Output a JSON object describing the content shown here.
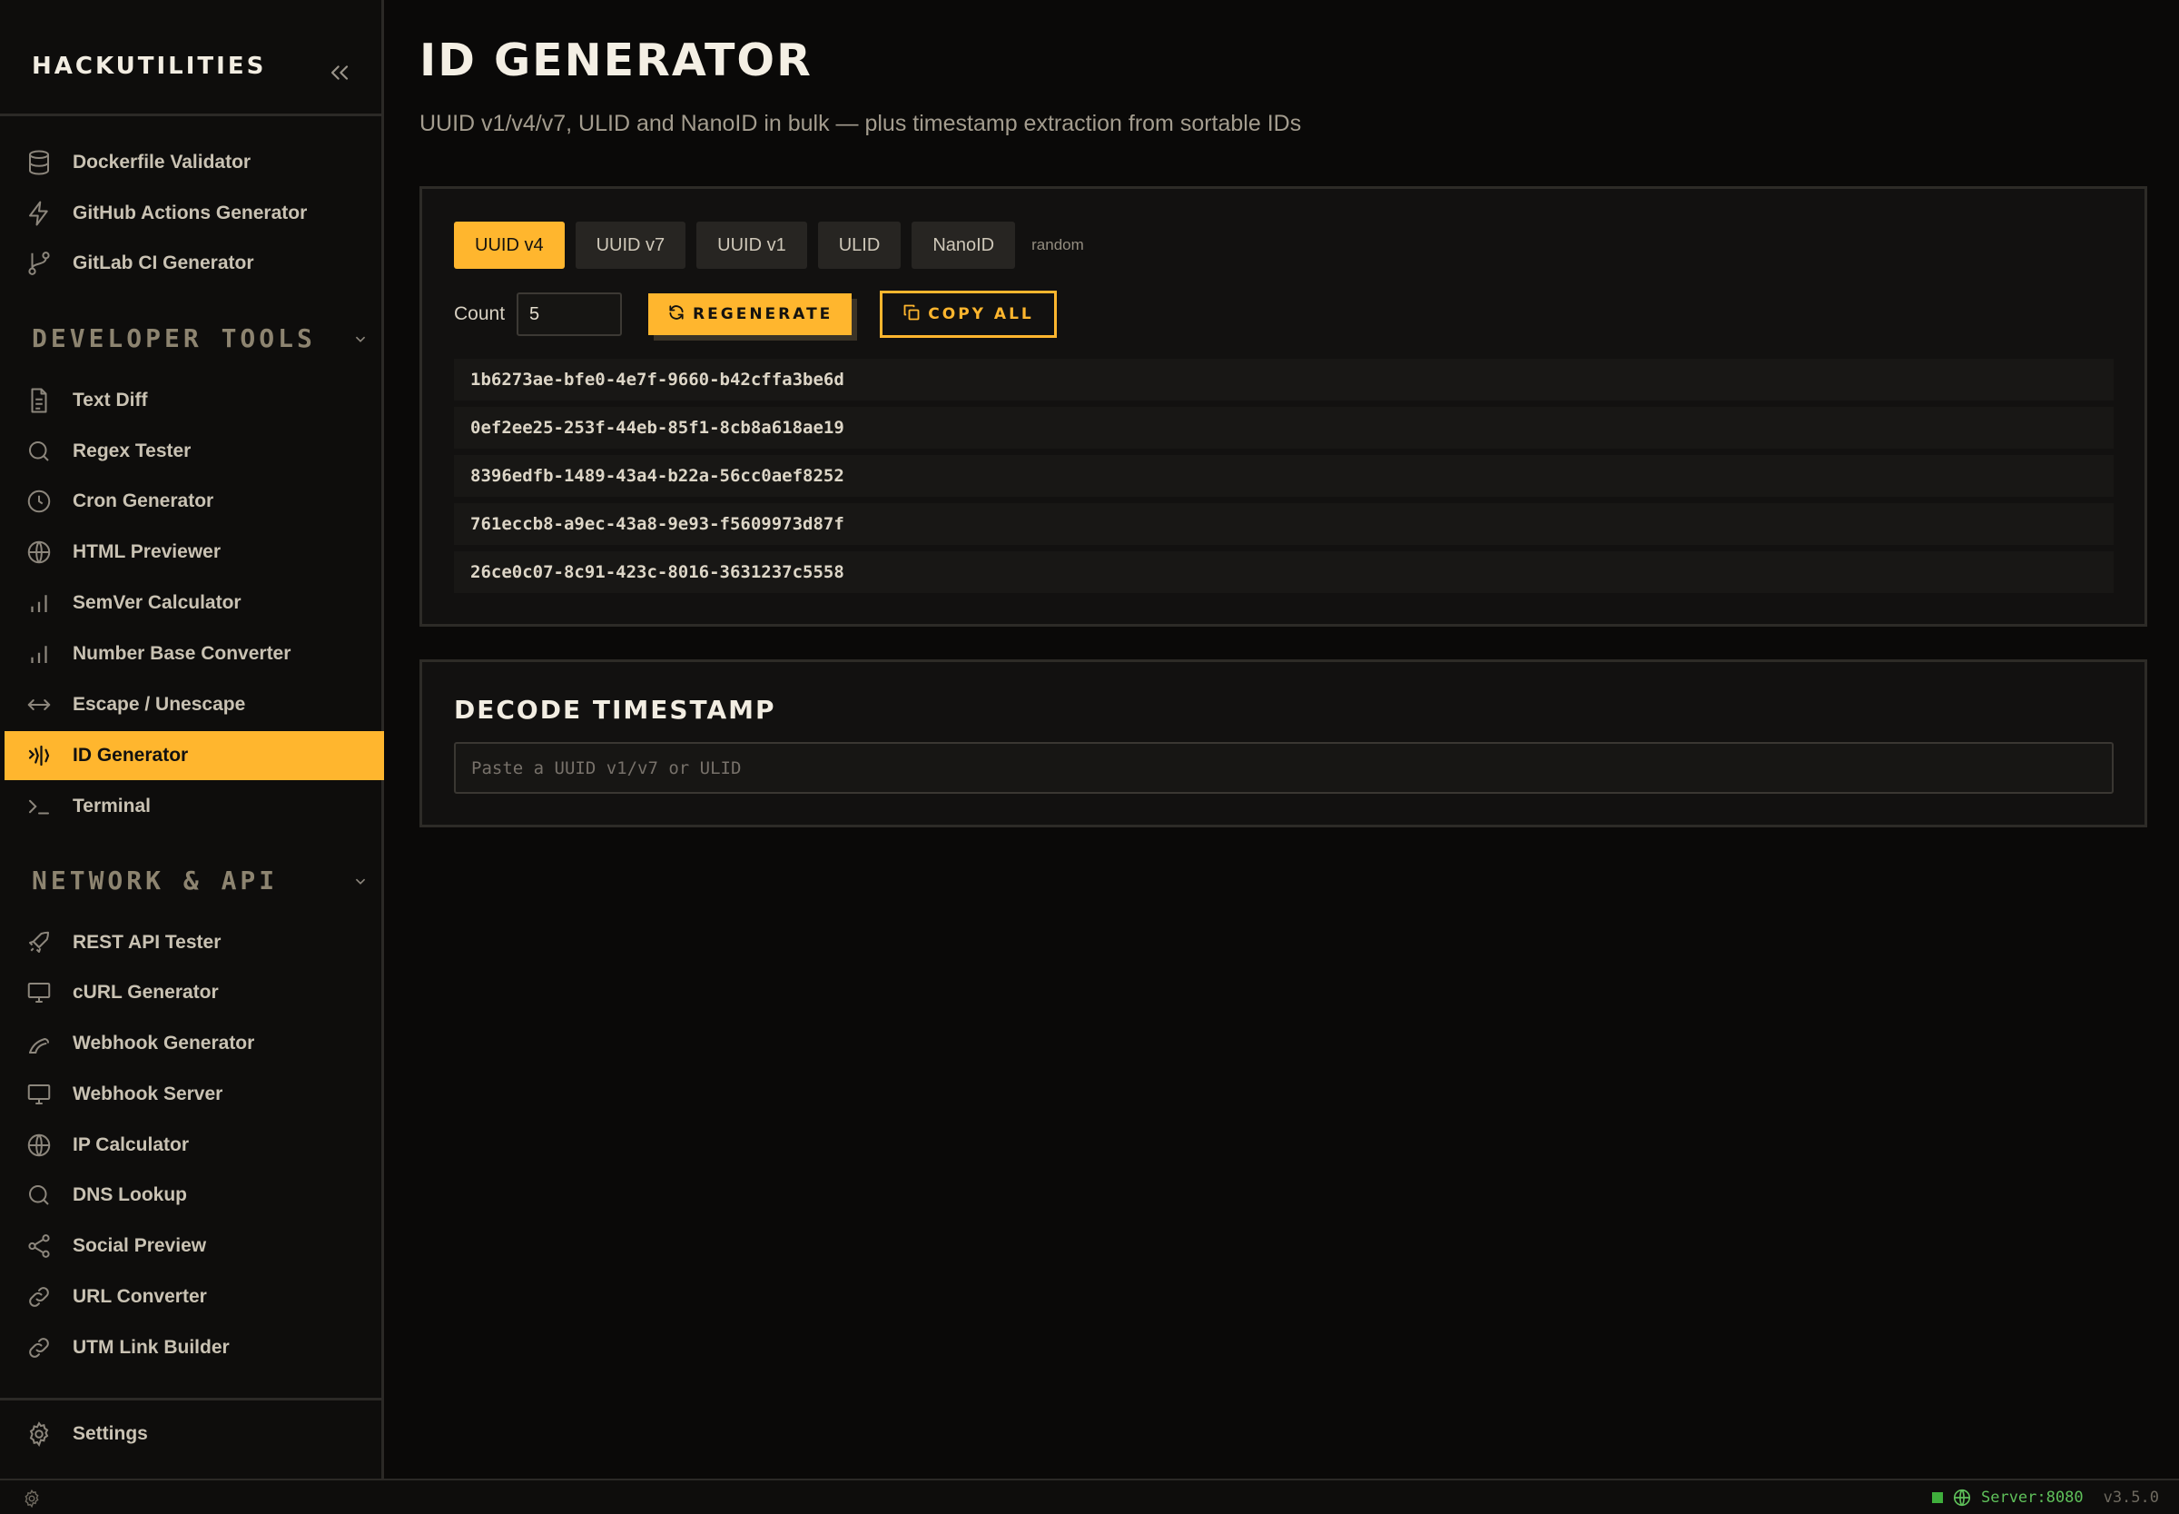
{
  "sidebar": {
    "brand": "HACKUTILITIES",
    "top_items": [
      {
        "label": "Dockerfile Validator",
        "icon": "database-icon"
      },
      {
        "label": "GitHub Actions Generator",
        "icon": "bolt-icon"
      },
      {
        "label": "GitLab CI Generator",
        "icon": "git-branch-icon"
      }
    ],
    "sections": [
      {
        "title": "DEVELOPER TOOLS",
        "items": [
          {
            "label": "Text Diff",
            "icon": "document-icon"
          },
          {
            "label": "Regex Tester",
            "icon": "search-icon"
          },
          {
            "label": "Cron Generator",
            "icon": "clock-icon"
          },
          {
            "label": "HTML Previewer",
            "icon": "globe-icon"
          },
          {
            "label": "SemVer Calculator",
            "icon": "bar-chart-icon"
          },
          {
            "label": "Number Base Converter",
            "icon": "bar-chart-icon"
          },
          {
            "label": "Escape / Unescape",
            "icon": "arrows-horizontal-icon"
          },
          {
            "label": "ID Generator",
            "icon": "fingerprint-icon",
            "active": true
          },
          {
            "label": "Terminal",
            "icon": "terminal-icon"
          }
        ]
      },
      {
        "title": "NETWORK & API",
        "items": [
          {
            "label": "REST API Tester",
            "icon": "rocket-icon"
          },
          {
            "label": "cURL Generator",
            "icon": "monitor-icon"
          },
          {
            "label": "Webhook Generator",
            "icon": "webhook-icon"
          },
          {
            "label": "Webhook Server",
            "icon": "monitor-icon"
          },
          {
            "label": "IP Calculator",
            "icon": "globe-icon"
          },
          {
            "label": "DNS Lookup",
            "icon": "search-icon"
          },
          {
            "label": "Social Preview",
            "icon": "share-icon"
          },
          {
            "label": "URL Converter",
            "icon": "link-icon"
          },
          {
            "label": "UTM Link Builder",
            "icon": "link-icon"
          }
        ]
      }
    ],
    "settings_label": "Settings"
  },
  "main": {
    "title": "ID GENERATOR",
    "subtitle": "UUID v1/v4/v7, ULID and NanoID in bulk — plus timestamp extraction from sortable IDs",
    "tabs": [
      {
        "label": "UUID v4",
        "active": true
      },
      {
        "label": "UUID v7"
      },
      {
        "label": "UUID v1"
      },
      {
        "label": "ULID"
      },
      {
        "label": "NanoID"
      }
    ],
    "tab_hint": "random",
    "count_label": "Count",
    "count_value": "5",
    "regenerate_label": "REGENERATE",
    "copy_all_label": "COPY ALL",
    "ids": [
      "1b6273ae-bfe0-4e7f-9660-b42cffa3be6d",
      "0ef2ee25-253f-44eb-85f1-8cb8a618ae19",
      "8396edfb-1489-43a4-b22a-56cc0aef8252",
      "761eccb8-a9ec-43a8-9e93-f5609973d87f",
      "26ce0c07-8c91-423c-8016-3631237c5558"
    ],
    "decode_title": "DECODE TIMESTAMP",
    "decode_placeholder": "Paste a UUID v1/v7 or ULID"
  },
  "statusbar": {
    "server": "Server:8080",
    "version": "v3.5.0"
  },
  "colors": {
    "accent": "#ffb62e",
    "background": "#0a0908",
    "panel": "#121110",
    "status_ok": "#5fc05a"
  }
}
